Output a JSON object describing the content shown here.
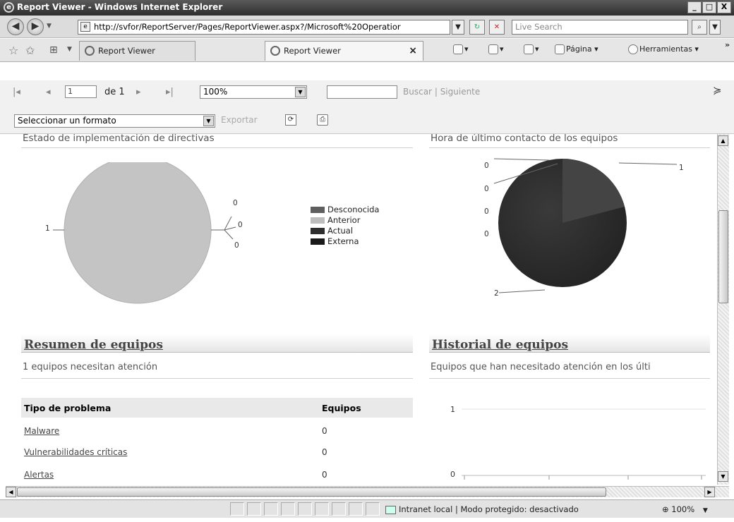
{
  "window": {
    "title": "Report Viewer - Windows Internet Explorer",
    "ie_icon": "ie-logo-icon",
    "minimize": "_",
    "maximize": "□",
    "close": "X"
  },
  "address_bar": {
    "url": "http://svfor/ReportServer/Pages/ReportViewer.aspx?/Microsoft%20Operatior",
    "search_placeholder": "Live Search"
  },
  "tabs": [
    {
      "label": "Report Viewer"
    },
    {
      "label": "Report Viewer"
    }
  ],
  "tab_close": "×",
  "command_bar": {
    "page_label": "Página",
    "tools_label": "Herramientas"
  },
  "report_toolbar": {
    "page_number": "1",
    "page_of": "de 1",
    "zoom": "100%",
    "find_label": "Buscar",
    "separator": "|",
    "next_label": "Siguiente",
    "format_placeholder": "Seleccionar un formato",
    "export_label": "Exportar"
  },
  "policy_chart": {
    "title": "Estado de implementación de directivas",
    "chart_data": {
      "type": "pie",
      "labels": [
        "Desconocida",
        "Anterior",
        "Actual",
        "Externa"
      ],
      "values": [
        0,
        1,
        0,
        0
      ],
      "data_labels": [
        "1",
        "0",
        "0",
        "0"
      ],
      "colors": [
        "#5f5f5f",
        "#bdbdbd",
        "#2e2e2e",
        "#1a1a1a"
      ],
      "legend_position": "right"
    }
  },
  "contact_chart": {
    "title": "Hora de último contacto de los equipos",
    "chart_data": {
      "type": "pie",
      "values": [
        1,
        2,
        0,
        0,
        0,
        0
      ],
      "data_labels": [
        "1",
        "2",
        "0",
        "0",
        "0",
        "0"
      ],
      "colors": [
        "#3d3d3d",
        "#2a2a2a",
        "#555555",
        "#555555",
        "#555555",
        "#555555"
      ]
    }
  },
  "computers_summary": {
    "title": "Resumen de equipos",
    "subtitle": "1 equipos necesitan atención",
    "table_headers": [
      "Tipo de problema",
      "Equipos"
    ],
    "rows": [
      {
        "problem": "Malware",
        "count": "0"
      },
      {
        "problem": "Vulnerabilidades críticas",
        "count": "0"
      },
      {
        "problem": "Alertas",
        "count": "0"
      }
    ]
  },
  "computers_history": {
    "title": "Historial de equipos",
    "subtitle": "Equipos que han necesitado atención en los últi",
    "chart_data": {
      "type": "line",
      "ytick_labels": [
        "1",
        "0"
      ],
      "ylim": [
        0,
        1
      ]
    }
  },
  "status_bar": {
    "zone": "Intranet local | Modo protegido: desactivado",
    "zoom": "100%"
  }
}
